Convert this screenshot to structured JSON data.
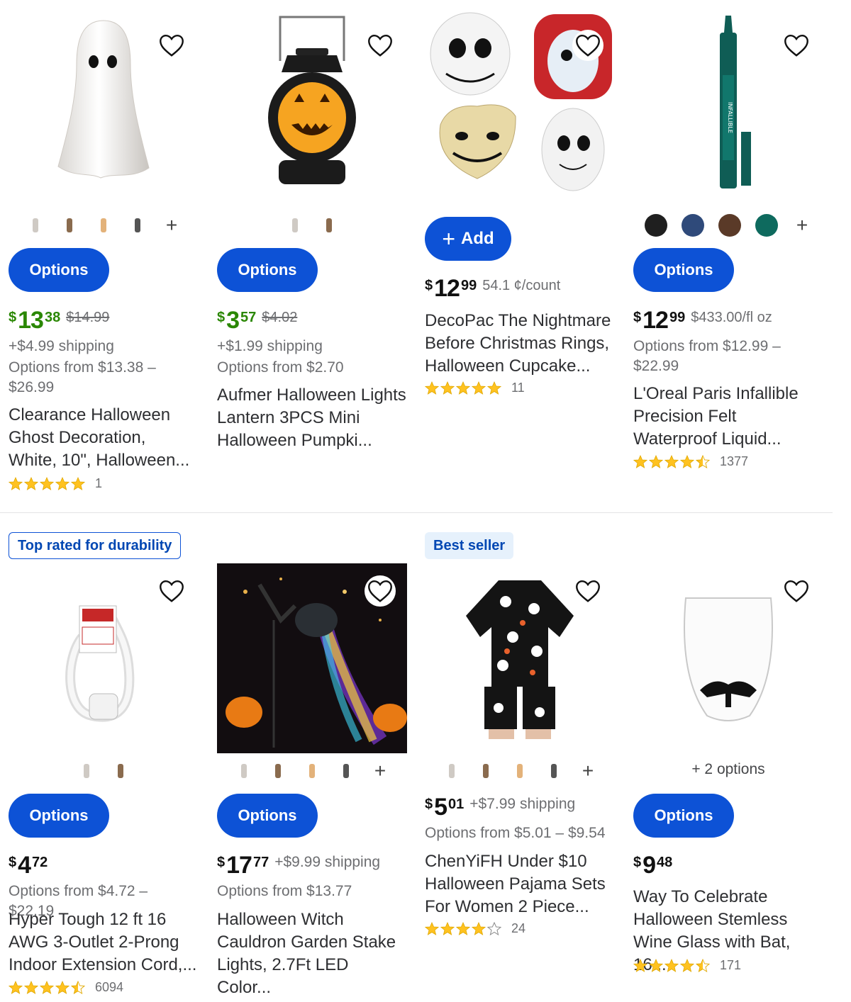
{
  "products": [
    {
      "title": "Clearance Halloween Ghost Decoration, White, 10\", Halloween...",
      "price": {
        "dollars": "13",
        "cents": "38",
        "currency": "$",
        "color": "#2a8703"
      },
      "was_price": "$14.99",
      "shipping": "+$4.99 shipping",
      "options_from": "Options from $13.38 –\n$26.99",
      "button": "Options",
      "rating": 5,
      "review_count": "1",
      "swatches": [
        "ghost-thumb-1-icon",
        "ghost-thumb-2-icon",
        "ghost-thumb-3-icon",
        "ghost-thumb-4-icon"
      ],
      "image_icon": "ghost-figure-icon"
    },
    {
      "title": "Aufmer Halloween Lights Lantern 3PCS Mini Halloween Pumpki...",
      "price": {
        "dollars": "3",
        "cents": "57",
        "currency": "$",
        "color": "#2a8703"
      },
      "was_price": "$4.02",
      "shipping": "+$1.99 shipping",
      "options_from": "Options from $2.70",
      "button": "Options",
      "swatches": [
        "lantern-thumb-1-icon",
        "lantern-thumb-2-icon"
      ],
      "image_icon": "pumpkin-lantern-icon"
    },
    {
      "title": "DecoPac The Nightmare Before Christmas Rings, Halloween Cupcake...",
      "price": {
        "dollars": "12",
        "cents": "99",
        "currency": "$",
        "color": "#111111"
      },
      "unit_price": "54.1 ¢/count",
      "button": "Add",
      "rating": 5,
      "review_count": "11",
      "image_icon": "nightmare-rings-icon"
    },
    {
      "title": "L'Oreal Paris Infallible Precision Felt Waterproof Liquid...",
      "price": {
        "dollars": "12",
        "cents": "99",
        "currency": "$",
        "color": "#111111"
      },
      "unit_price": "$433.00/fl oz",
      "options_from": "Options from $12.99 –\n$22.99",
      "button": "Options",
      "rating": 4.5,
      "review_count": "1377",
      "color_swatches": [
        "#1f1f1f",
        "#2f4a7a",
        "#5a3a28",
        "#0e6a5e"
      ],
      "image_icon": "eyeliner-pen-icon"
    },
    {
      "badge": "Top rated for durability",
      "title": "Hyper Tough 12 ft 16 AWG 3-Outlet 2-Prong Indoor Extension Cord,...",
      "price": {
        "dollars": "4",
        "cents": "72",
        "currency": "$",
        "color": "#111111"
      },
      "options_from": "Options from $4.72 – $22.19",
      "button": "Options",
      "rating": 4.5,
      "review_count": "6094",
      "swatches": [
        "cord-thumb-1-icon",
        "cord-thumb-2-icon"
      ],
      "image_icon": "extension-cord-icon"
    },
    {
      "title": "Halloween Witch Cauldron Garden Stake Lights, 2.7Ft LED Color...",
      "price": {
        "dollars": "17",
        "cents": "77",
        "currency": "$",
        "color": "#111111"
      },
      "shipping": "+$9.99 shipping",
      "options_from": "Options from $13.77",
      "button": "Options",
      "swatches": [
        "stake-thumb-1-icon",
        "stake-thumb-2-icon",
        "stake-thumb-3-icon",
        "stake-thumb-4-icon"
      ],
      "image_icon": "witch-cauldron-icon"
    },
    {
      "badge": "Best seller",
      "title": "ChenYiFH Under $10 Halloween Pajama Sets For Women 2 Piece...",
      "price": {
        "dollars": "5",
        "cents": "01",
        "currency": "$",
        "color": "#111111"
      },
      "shipping": "+$7.99 shipping",
      "options_from": "Options from $5.01 – $9.54",
      "rating": 4,
      "review_count": "24",
      "swatches": [
        "pajama-thumb-1-icon",
        "pajama-thumb-2-icon",
        "pajama-thumb-3-icon",
        "pajama-thumb-4-icon"
      ],
      "image_icon": "ghost-pajama-icon"
    },
    {
      "title": "Way To Celebrate Halloween Stemless Wine Glass with Bat, 16....",
      "price": {
        "dollars": "9",
        "cents": "48",
        "currency": "$",
        "color": "#111111"
      },
      "more_options": "+ 2 options",
      "button": "Options",
      "rating": 4.5,
      "review_count": "171",
      "image_icon": "bat-wine-glass-icon"
    }
  ],
  "ui": {
    "favorite_icon": "heart-outline-icon",
    "more_swatches_glyph": "+",
    "add_glyph": "+",
    "accent": "#0d52d6",
    "sale_green": "#2a8703",
    "star_color": "#ffc220"
  }
}
